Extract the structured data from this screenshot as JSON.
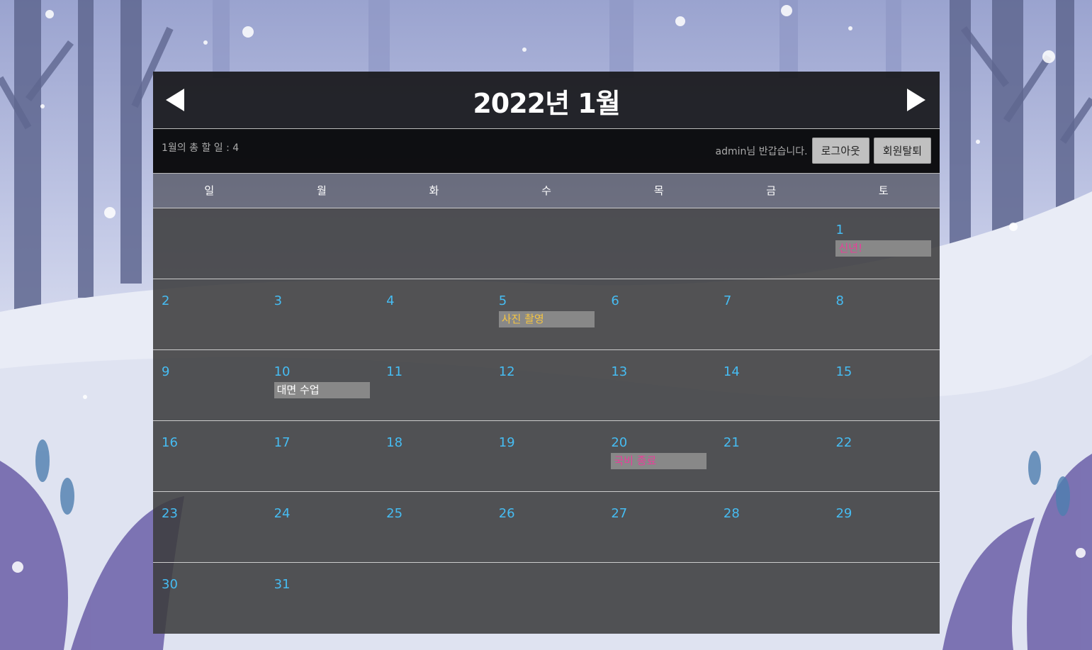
{
  "header": {
    "title": "2022년 1월",
    "prev_label": "이전 달",
    "next_label": "다음 달"
  },
  "bar": {
    "total": "1월의 총 할 일 : 4",
    "welcome": "admin님 반갑습니다.",
    "logout_label": "로그아웃",
    "withdraw_label": "회원탈퇴"
  },
  "weekdays": [
    "일",
    "월",
    "화",
    "수",
    "목",
    "금",
    "토"
  ],
  "colors": {
    "day_number": "#46bcf2",
    "event_bg": "#888888"
  },
  "weeks": [
    [
      {
        "day": ""
      },
      {
        "day": ""
      },
      {
        "day": ""
      },
      {
        "day": ""
      },
      {
        "day": ""
      },
      {
        "day": ""
      },
      {
        "day": "1",
        "event": "신년!",
        "event_color": "#e83e9a"
      }
    ],
    [
      {
        "day": "2"
      },
      {
        "day": "3"
      },
      {
        "day": "4"
      },
      {
        "day": "5",
        "event": "사진 촬영",
        "event_color": "#f5c542"
      },
      {
        "day": "6"
      },
      {
        "day": "7"
      },
      {
        "day": "8"
      }
    ],
    [
      {
        "day": "9"
      },
      {
        "day": "10",
        "event": "대면 수업",
        "event_color": "#ffffff"
      },
      {
        "day": "11"
      },
      {
        "day": "12"
      },
      {
        "day": "13"
      },
      {
        "day": "14"
      },
      {
        "day": "15"
      }
    ],
    [
      {
        "day": "16"
      },
      {
        "day": "17"
      },
      {
        "day": "18"
      },
      {
        "day": "19"
      },
      {
        "day": "20",
        "event": "국비 종료",
        "event_color": "#e83e9a"
      },
      {
        "day": "21"
      },
      {
        "day": "22"
      }
    ],
    [
      {
        "day": "23"
      },
      {
        "day": "24"
      },
      {
        "day": "25"
      },
      {
        "day": "26"
      },
      {
        "day": "27"
      },
      {
        "day": "28"
      },
      {
        "day": "29"
      }
    ],
    [
      {
        "day": "30"
      },
      {
        "day": "31"
      },
      {
        "day": ""
      },
      {
        "day": ""
      },
      {
        "day": ""
      },
      {
        "day": ""
      },
      {
        "day": ""
      }
    ]
  ]
}
